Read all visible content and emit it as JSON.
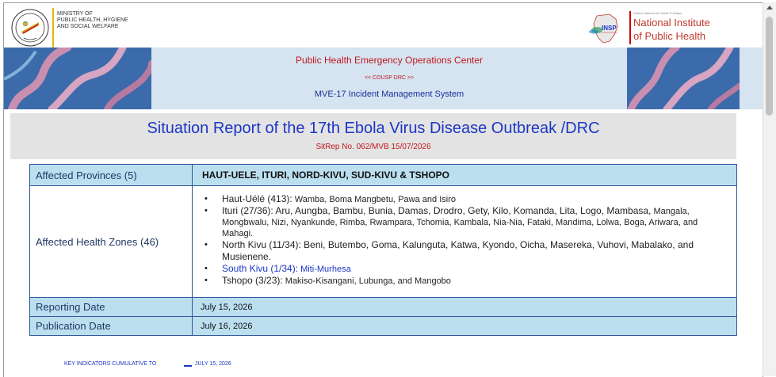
{
  "header": {
    "ministry_lines": [
      "MINISTRY OF",
      "PUBLIC HEALTH, HYGIENE",
      "AND SOCIAL WELFARE"
    ],
    "insp_small": "Institut National de Santé Publique",
    "insp_name_lines": [
      "National Institute",
      "of Public Health"
    ],
    "insp_logo_text": "INSP"
  },
  "banner": {
    "line1": "Public Health Emergency Operations Center",
    "line2": "<< COUSP DRC >>",
    "line3": "MVE-17 Incident Management System"
  },
  "report": {
    "title": "Situation Report of the 17th Ebola Virus Disease Outbreak /DRC",
    "sitrep": "SitRep No. 062/MVB 15/07/2026"
  },
  "table": {
    "provinces_label": "Affected Provinces (5)",
    "provinces_value": "HAUT-UELE, ITURI, NORD-KIVU, SUD-KIVU & TSHOPO",
    "zones_label": "Affected Health Zones (46)",
    "zones": [
      {
        "lead": "Haut-Uélé (413):",
        "body": " Wamba, Boma Mangbetu, Pawa and Isiro"
      },
      {
        "lead": "Ituri (27/36): Aru, Aungba, Bambu, Bunia, Damas, Drodro, Gety, Kilo, Komanda, Lita, Logo, Mambasa,",
        "body": " Mangala, Mongbwalu, Nizi, Nyankunde, Rimba, Rwampara, Tchomia, Kambala, Nia-Nia, Fataki, Mandima, Lolwa, Boga, Ariwara, and Mahagi."
      },
      {
        "lead": "North Kivu (11/34):",
        "body": " Beni, Butembo, Goma, Kalunguta, Katwa, Kyondo, Oicha, Masereka, Vuhovi, Mabalako, and Musienene."
      },
      {
        "lead": "South Kivu (1/34):",
        "body": " Miti-Murhesa"
      },
      {
        "lead": "Tshopo (3/23):",
        "body": " Makiso-Kisangani, Lubunga, and Mangobo"
      }
    ],
    "reporting_label": "Reporting Date",
    "reporting_value": "July 15, 2026",
    "publication_label": "Publication Date",
    "publication_value": "July 16, 2026"
  },
  "footer": {
    "key_indicators": "KEY INDICATORS CUMULATIVE TO",
    "key_date": "JULY 15, 2026"
  }
}
